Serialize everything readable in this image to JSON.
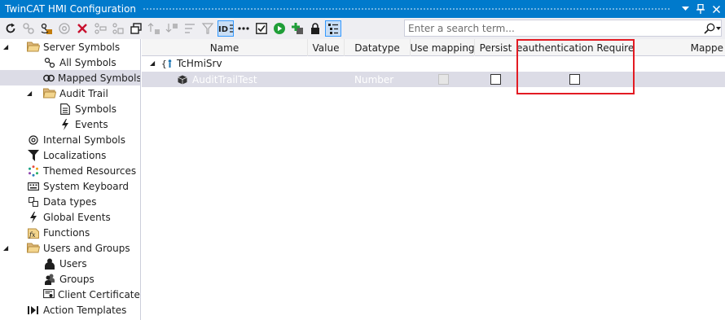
{
  "window": {
    "title": "TwinCAT HMI Configuration"
  },
  "titlebar_buttons": [
    {
      "name": "window-position-button",
      "icon": "chevron-down-icon"
    },
    {
      "name": "pin-button",
      "icon": "pin-icon"
    },
    {
      "name": "close-button",
      "icon": "close-icon"
    }
  ],
  "toolbar": {
    "search": {
      "placeholder": "Enter a search term...",
      "value": "",
      "icon": "search-icon"
    },
    "tools": [
      {
        "name": "refresh",
        "icon": "refresh-icon",
        "state": "enabled"
      },
      {
        "name": "add-symbol",
        "icon": "symbol-add-icon",
        "state": "disabled"
      },
      {
        "name": "map-symbol",
        "icon": "map-symbol-icon",
        "state": "enabled"
      },
      {
        "name": "internal-symbol",
        "icon": "at-icon",
        "state": "disabled"
      },
      {
        "name": "delete",
        "icon": "delete-x-icon",
        "state": "enabled"
      },
      {
        "name": "cut",
        "icon": "cut-icon",
        "state": "disabled"
      },
      {
        "name": "copy",
        "icon": "copy-icon",
        "state": "disabled"
      },
      {
        "name": "duplicate",
        "icon": "duplicate-icon",
        "state": "enabled"
      },
      {
        "name": "move-up",
        "icon": "move-up-icon",
        "state": "disabled"
      },
      {
        "name": "move-down",
        "icon": "move-down-icon",
        "state": "disabled"
      },
      {
        "name": "sort",
        "icon": "sort-icon",
        "state": "disabled"
      },
      {
        "name": "filter",
        "icon": "filter-icon",
        "state": "disabled"
      },
      {
        "name": "id-view",
        "icon": "id-icon",
        "state": "active"
      },
      {
        "name": "more",
        "icon": "ellipsis-icon",
        "state": "enabled"
      },
      {
        "name": "check",
        "icon": "checkbox-icon",
        "state": "enabled"
      },
      {
        "name": "run",
        "icon": "play-icon",
        "state": "enabled"
      },
      {
        "name": "add-item",
        "icon": "plus-green-icon",
        "state": "enabled"
      },
      {
        "name": "lock",
        "icon": "lock-icon",
        "state": "enabled"
      },
      {
        "name": "list-view",
        "icon": "list-icon",
        "state": "active"
      }
    ]
  },
  "sidebar": {
    "items": [
      {
        "label": "Server Symbols",
        "icon": "folder-open-icon",
        "indent": 1,
        "expander": "collapse",
        "selected": false
      },
      {
        "label": "All Symbols",
        "icon": "symbols-icon",
        "indent": 2,
        "expander": "",
        "selected": false
      },
      {
        "label": "Mapped Symbols",
        "icon": "link-icon",
        "indent": 2,
        "expander": "",
        "selected": true
      },
      {
        "label": "Audit Trail",
        "icon": "folder-open-icon",
        "indent": 2,
        "expander": "collapse",
        "selected": false
      },
      {
        "label": "Symbols",
        "icon": "document-icon",
        "indent": 3,
        "expander": "",
        "selected": false
      },
      {
        "label": "Events",
        "icon": "lightning-icon",
        "indent": 3,
        "expander": "",
        "selected": false
      },
      {
        "label": "Internal Symbols",
        "icon": "at-icon",
        "indent": 1,
        "expander": "",
        "selected": false
      },
      {
        "label": "Localizations",
        "icon": "flag-icon",
        "indent": 1,
        "expander": "",
        "selected": false
      },
      {
        "label": "Themed Resources",
        "icon": "palette-icon",
        "indent": 1,
        "expander": "",
        "selected": false
      },
      {
        "label": "System Keyboard",
        "icon": "keyboard-icon",
        "indent": 1,
        "expander": "",
        "selected": false
      },
      {
        "label": "Data types",
        "icon": "datatype-icon",
        "indent": 1,
        "expander": "",
        "selected": false
      },
      {
        "label": "Global Events",
        "icon": "lightning-icon",
        "indent": 1,
        "expander": "",
        "selected": false
      },
      {
        "label": "Functions",
        "icon": "function-icon",
        "indent": 1,
        "expander": "",
        "selected": false
      },
      {
        "label": "Users and Groups",
        "icon": "folder-open-icon",
        "indent": 1,
        "expander": "collapse",
        "selected": false
      },
      {
        "label": "Users",
        "icon": "user-icon",
        "indent": 2,
        "expander": "",
        "selected": false
      },
      {
        "label": "Groups",
        "icon": "group-icon",
        "indent": 2,
        "expander": "",
        "selected": false
      },
      {
        "label": "Client Certificates",
        "icon": "certificate-icon",
        "indent": 2,
        "expander": "",
        "selected": false
      },
      {
        "label": "Action Templates",
        "icon": "action-template-icon",
        "indent": 1,
        "expander": "",
        "selected": false
      }
    ]
  },
  "grid": {
    "columns": [
      {
        "key": "name",
        "label": "Name"
      },
      {
        "key": "value",
        "label": "Value"
      },
      {
        "key": "datatype",
        "label": "Datatype"
      },
      {
        "key": "use_mapping",
        "label": "Use mapping"
      },
      {
        "key": "persist",
        "label": "Persist"
      },
      {
        "key": "reauth",
        "label": "Reauthentication Required"
      },
      {
        "key": "mapped",
        "label": "Mappe"
      }
    ],
    "rows": [
      {
        "type": "group",
        "name": "TcHmiSrv",
        "icon": "server-symbol-icon",
        "expander": "collapse"
      },
      {
        "type": "symbol",
        "name": "AuditTrailTest",
        "icon": "cube-icon",
        "value": "",
        "datatype": "Number",
        "use_mapping": {
          "checked": false,
          "enabled": false
        },
        "persist": {
          "checked": false,
          "enabled": true
        },
        "reauth": {
          "checked": false,
          "enabled": true
        },
        "highlighted": true
      }
    ]
  },
  "annotation": {
    "color": "#e31b23",
    "target_column": "reauth"
  },
  "colors": {
    "titlebar": "#007acc",
    "toolbar": "#eeeef2",
    "selection": "#dcdce6",
    "annotation": "#e31b23"
  }
}
